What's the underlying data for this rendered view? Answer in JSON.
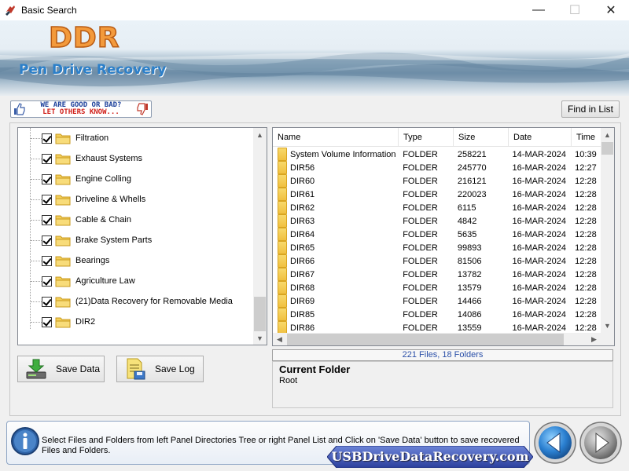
{
  "window": {
    "title": "Basic Search",
    "minimize": "—",
    "maximize": "☐",
    "close": "✕"
  },
  "banner": {
    "logo": "DDR",
    "product": "Pen Drive Recovery"
  },
  "feedback": {
    "line1": "WE ARE GOOD OR BAD?",
    "line2": "LET OTHERS KNOW..."
  },
  "toolbar": {
    "find_label": "Find in List"
  },
  "tree": {
    "items": [
      "Filtration",
      "Exhaust Systems",
      "Engine Colling",
      "Driveline & Whells",
      "Cable & Chain",
      "Brake System Parts",
      "Bearings",
      "Agriculture Law",
      "(21)Data Recovery for Removable Media",
      "DIR2"
    ]
  },
  "list": {
    "columns": [
      "Name",
      "Type",
      "Size",
      "Date",
      "Time"
    ],
    "rows": [
      [
        "System Volume Information",
        "FOLDER",
        "258221",
        "14-MAR-2024",
        "10:39"
      ],
      [
        "DIR56",
        "FOLDER",
        "245770",
        "16-MAR-2024",
        "12:27"
      ],
      [
        "DIR60",
        "FOLDER",
        "216121",
        "16-MAR-2024",
        "12:28"
      ],
      [
        "DIR61",
        "FOLDER",
        "220023",
        "16-MAR-2024",
        "12:28"
      ],
      [
        "DIR62",
        "FOLDER",
        "6115",
        "16-MAR-2024",
        "12:28"
      ],
      [
        "DIR63",
        "FOLDER",
        "4842",
        "16-MAR-2024",
        "12:28"
      ],
      [
        "DIR64",
        "FOLDER",
        "5635",
        "16-MAR-2024",
        "12:28"
      ],
      [
        "DIR65",
        "FOLDER",
        "99893",
        "16-MAR-2024",
        "12:28"
      ],
      [
        "DIR66",
        "FOLDER",
        "81506",
        "16-MAR-2024",
        "12:28"
      ],
      [
        "DIR67",
        "FOLDER",
        "13782",
        "16-MAR-2024",
        "12:28"
      ],
      [
        "DIR68",
        "FOLDER",
        "13579",
        "16-MAR-2024",
        "12:28"
      ],
      [
        "DIR69",
        "FOLDER",
        "14466",
        "16-MAR-2024",
        "12:28"
      ],
      [
        "DIR85",
        "FOLDER",
        "14086",
        "16-MAR-2024",
        "12:28"
      ],
      [
        "DIR86",
        "FOLDER",
        "13559",
        "16-MAR-2024",
        "12:28"
      ]
    ]
  },
  "status": {
    "count": "221 Files, 18 Folders"
  },
  "current_folder": {
    "title": "Current Folder",
    "value": "Root"
  },
  "buttons": {
    "save_data": "Save Data",
    "save_log": "Save Log"
  },
  "bottom": {
    "message": "Select Files and Folders from left Panel Directories Tree or right Panel List and Click on 'Save Data' button to save recovered Files and Folders.",
    "site": "USBDriveDataRecovery.com"
  },
  "colors": {
    "accent": "#2b7fc9",
    "logo": "#f39a3c",
    "status_text": "#2a4fa8"
  }
}
